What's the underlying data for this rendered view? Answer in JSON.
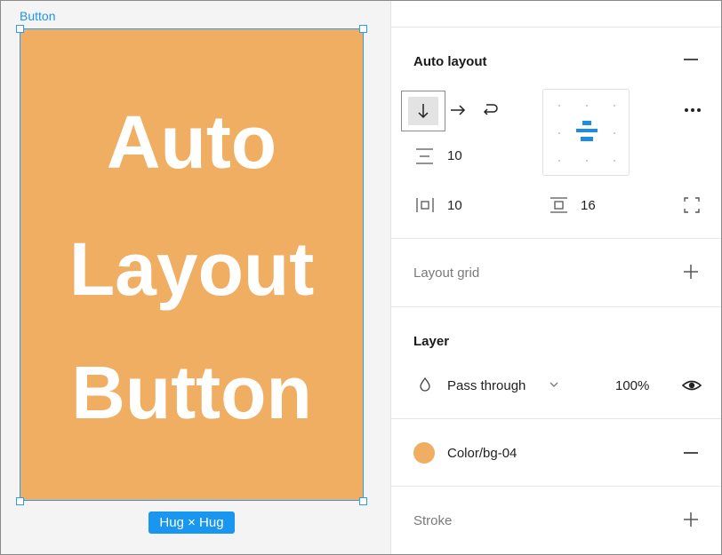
{
  "canvas": {
    "frame_label": "Button",
    "button_lines": [
      "Auto",
      "Layout",
      "Button"
    ],
    "hug_label": "Hug × Hug",
    "fill_color": "#f0ae62",
    "selection_color": "#2d9bf0"
  },
  "auto_layout": {
    "title": "Auto layout",
    "gap": "10",
    "padding_horizontal": "10",
    "padding_vertical": "16"
  },
  "layout_grid": {
    "title": "Layout grid"
  },
  "layer": {
    "title": "Layer",
    "blend_mode": "Pass through",
    "opacity": "100%"
  },
  "fill": {
    "style_name": "Color/bg-04",
    "swatch_color": "#f0ae62"
  },
  "stroke": {
    "title": "Stroke"
  }
}
